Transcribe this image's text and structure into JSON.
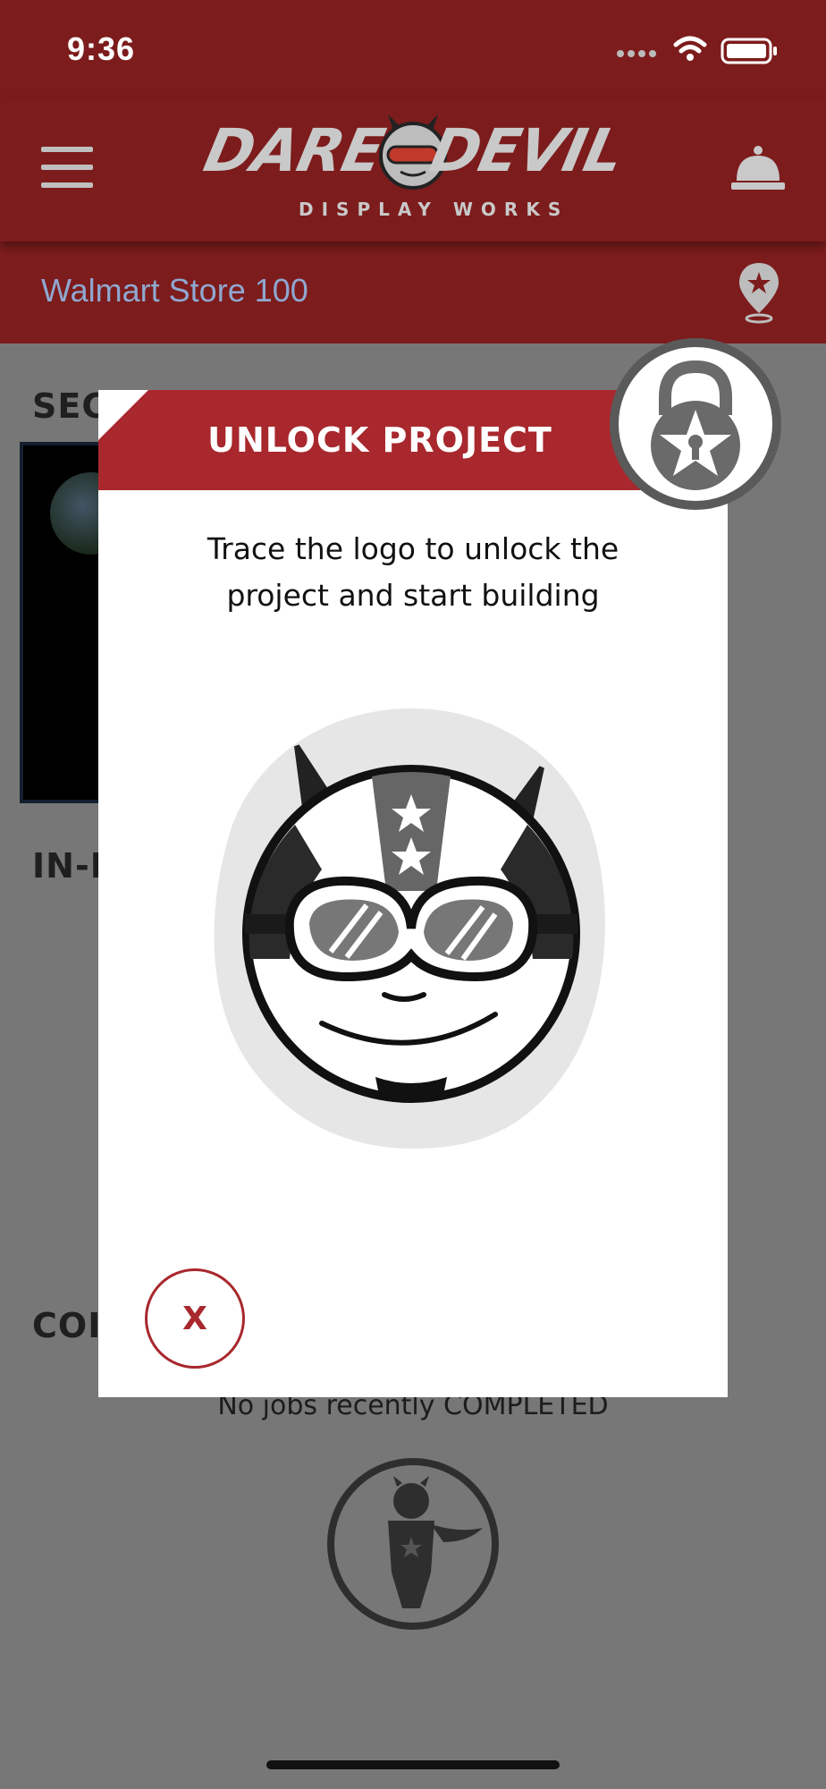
{
  "status_bar": {
    "time": "9:36"
  },
  "header": {
    "brand_line1_left": "DARE",
    "brand_line1_right": "DEVIL",
    "brand_line2": "DISPLAY WORKS",
    "menu_icon": "hamburger-icon",
    "notify_icon": "service-bell-icon"
  },
  "store_bar": {
    "store_name": "Walmart Store 100",
    "location_icon": "star-map-pin-icon"
  },
  "sections": {
    "secured_title": "SECU",
    "in_progress_title": "IN-I",
    "completed_title": "COI",
    "completed_empty_text": "No jobs recently COMPLETED"
  },
  "modal": {
    "title": "UNLOCK PROJECT",
    "message_line1": "Trace the logo to unlock the",
    "message_line2": "project and start building",
    "close_label": "X",
    "badge_icon": "padlock-star-icon",
    "trace_icon": "devil-helmet-logo-icon"
  },
  "colors": {
    "brand_red": "#7d1c1c",
    "modal_red": "#a8282d",
    "store_text": "#8fa8d0"
  }
}
